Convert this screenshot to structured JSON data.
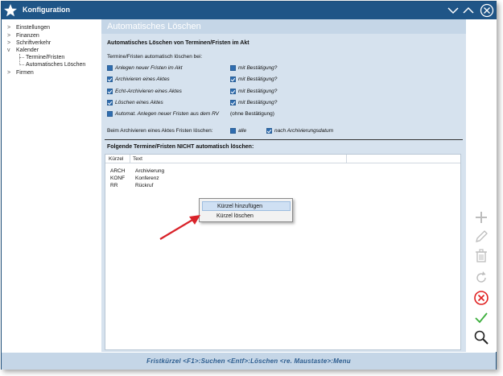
{
  "window": {
    "title": "Konfiguration"
  },
  "sidebar": {
    "items": [
      {
        "label": "Einstellungen",
        "expander": ">"
      },
      {
        "label": "Finanzen",
        "expander": ">"
      },
      {
        "label": "Schriftverkehr",
        "expander": ">"
      },
      {
        "label": "Kalender",
        "expander": "v"
      },
      {
        "label": "Termine/Fristen",
        "expander": ""
      },
      {
        "label": "Automatisches Löschen",
        "expander": ""
      },
      {
        "label": "Firmen",
        "expander": ">"
      }
    ]
  },
  "content": {
    "title": "Automatisches Löschen",
    "section_title": "Automatisches Löschen von Terminen/Fristen im Akt",
    "intro": "Termine/Fristen automatisch löschen bei:",
    "options": [
      {
        "label": "Anlegen neuer Fristen im Akt",
        "checked": false,
        "confirm_label": "mit Bestätigung?",
        "confirm_checked": false
      },
      {
        "label": "Archivieren eines Aktes",
        "checked": true,
        "confirm_label": "mit Bestätigung?",
        "confirm_checked": true
      },
      {
        "label": "Echt-Archivieren eines Aktes",
        "checked": true,
        "confirm_label": "mit Bestätigung?",
        "confirm_checked": true
      },
      {
        "label": "Löschen eines Aktes",
        "checked": true,
        "confirm_label": "mit Bestätigung?",
        "confirm_checked": true
      },
      {
        "label": "Automat. Anlegen neuer Fristen aus dem RV",
        "checked": false,
        "confirm_label": "(ohne Bestätigung)"
      }
    ],
    "archive_row": {
      "label": "Beim Archivieren eines Aktes Fristen löschen:",
      "opt_all": "alle",
      "opt_after": "nach Archivierungsdatum"
    },
    "exclude_title": "Folgende Termine/Fristen NICHT automatisch löschen:",
    "table": {
      "headers": [
        "Kürzel",
        "Text"
      ],
      "rows": [
        [
          "ARCH",
          "Archivierung"
        ],
        [
          "KONF",
          "Konferenz"
        ],
        [
          "RR",
          "Rückruf"
        ]
      ]
    }
  },
  "context_menu": {
    "items": [
      "Kürzel hinzufügen",
      "Kürzel löschen"
    ]
  },
  "right_toolbar": [
    "plus-icon",
    "pencil-icon",
    "trash-icon",
    "refresh-icon",
    "cancel-icon",
    "confirm-icon",
    "search-icon"
  ],
  "status": {
    "text": "Fristkürzel  <F1>:Suchen  <Entf>:Löschen  <re. Maustaste>:Menu"
  },
  "colors": {
    "titlebar": "#1f5587",
    "content_bg": "#d6e2ee",
    "accent": "#2f6db0",
    "arrow": "#d9232a"
  }
}
